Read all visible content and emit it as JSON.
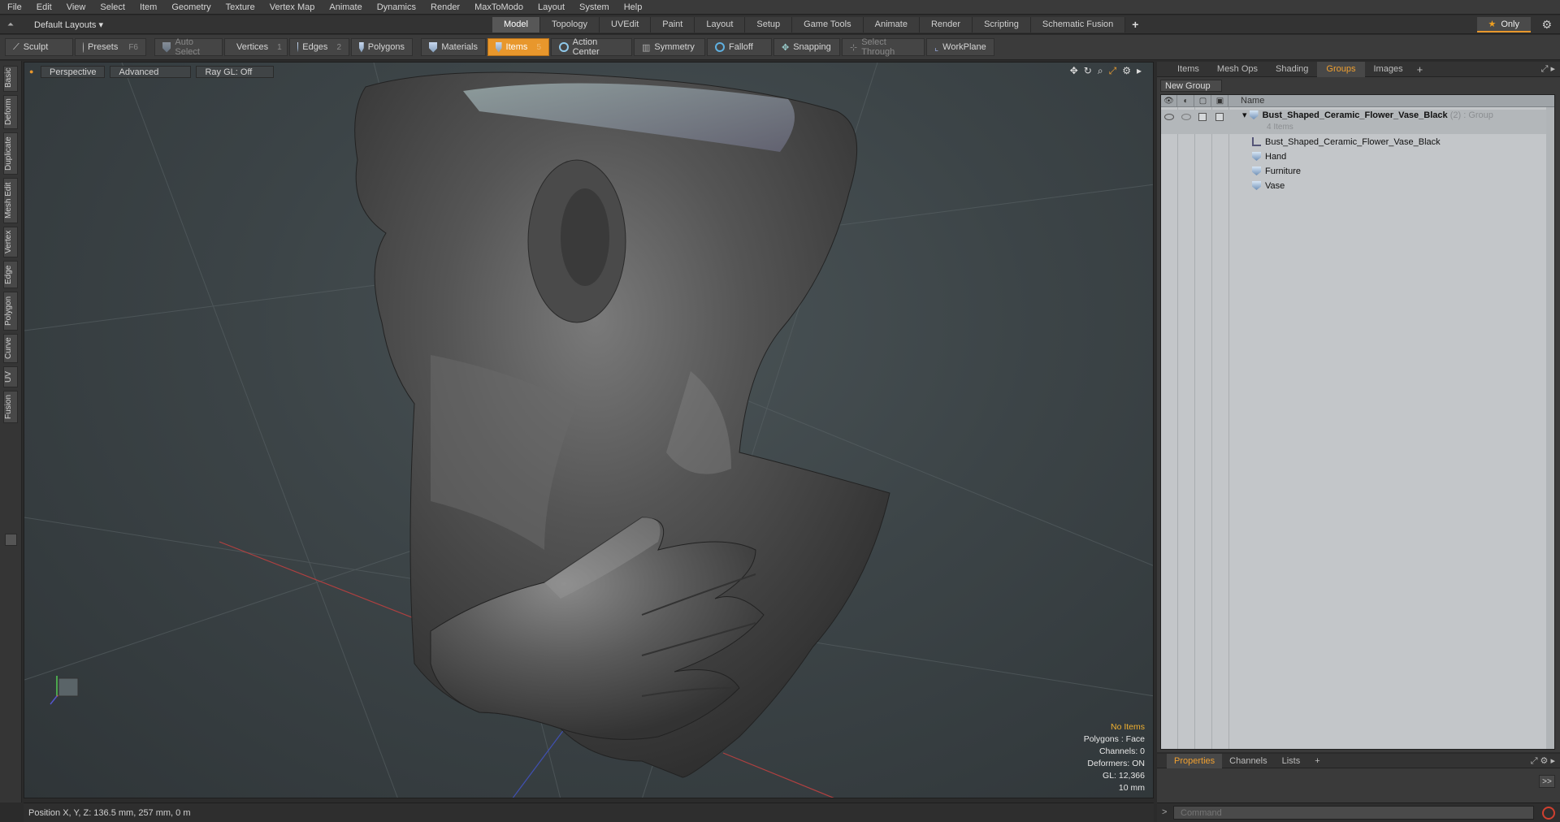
{
  "menu": [
    "File",
    "Edit",
    "View",
    "Select",
    "Item",
    "Geometry",
    "Texture",
    "Vertex Map",
    "Animate",
    "Dynamics",
    "Render",
    "MaxToModo",
    "Layout",
    "System",
    "Help"
  ],
  "layout_dropdown": "Default Layouts ▾",
  "tabs": [
    "Model",
    "Topology",
    "UVEdit",
    "Paint",
    "Layout",
    "Setup",
    "Game Tools",
    "Animate",
    "Render",
    "Scripting",
    "Schematic Fusion"
  ],
  "tab_add": "+",
  "only_label": "Only",
  "toolbar": {
    "sculpt": "Sculpt",
    "presets": "Presets",
    "presets_key": "F6",
    "auto_select": "Auto Select",
    "vertices": "Vertices",
    "vertices_num": "1",
    "edges": "Edges",
    "edges_num": "2",
    "polygons": "Polygons",
    "materials": "Materials",
    "items": "Items",
    "items_num": "5",
    "action_center": "Action Center",
    "symmetry": "Symmetry",
    "falloff": "Falloff",
    "snapping": "Snapping",
    "select_through": "Select Through",
    "workplane": "WorkPlane"
  },
  "left_tabs": [
    "Basic",
    "Deform",
    "Duplicate",
    "Mesh Edit",
    "Vertex",
    "Edge",
    "Polygon",
    "Curve",
    "UV",
    "Fusion"
  ],
  "viewport": {
    "perspective": "Perspective",
    "advanced": "Advanced",
    "raygl": "Ray GL: Off",
    "info": {
      "no_items": "No Items",
      "polygons": "Polygons : Face",
      "channels": "Channels: 0",
      "deformers": "Deformers: ON",
      "gl": "GL: 12,366",
      "scale": "10 mm"
    }
  },
  "status": "Position X, Y, Z:   136.5 mm, 257 mm, 0 m",
  "right_panel": {
    "tabs": [
      "Items",
      "Mesh Ops",
      "Shading",
      "Groups",
      "Images"
    ],
    "active_tab": "Groups",
    "tab_add": "+",
    "new_group": "New Group",
    "column_name": "Name",
    "group": {
      "name": "Bust_Shaped_Ceramic_Flower_Vase_Black",
      "count": "(2)",
      "type": ": Group",
      "items_count": "4 Items"
    },
    "children": [
      {
        "name": "Bust_Shaped_Ceramic_Flower_Vase_Black",
        "kind": "locator"
      },
      {
        "name": "Hand",
        "kind": "mesh"
      },
      {
        "name": "Furniture",
        "kind": "mesh"
      },
      {
        "name": "Vase",
        "kind": "mesh"
      }
    ]
  },
  "properties": {
    "tabs": [
      "Properties",
      "Channels",
      "Lists"
    ],
    "active_tab": "Properties",
    "tab_add": "+",
    "expand": ">>"
  },
  "command": {
    "prompt": ">",
    "placeholder": "Command"
  }
}
